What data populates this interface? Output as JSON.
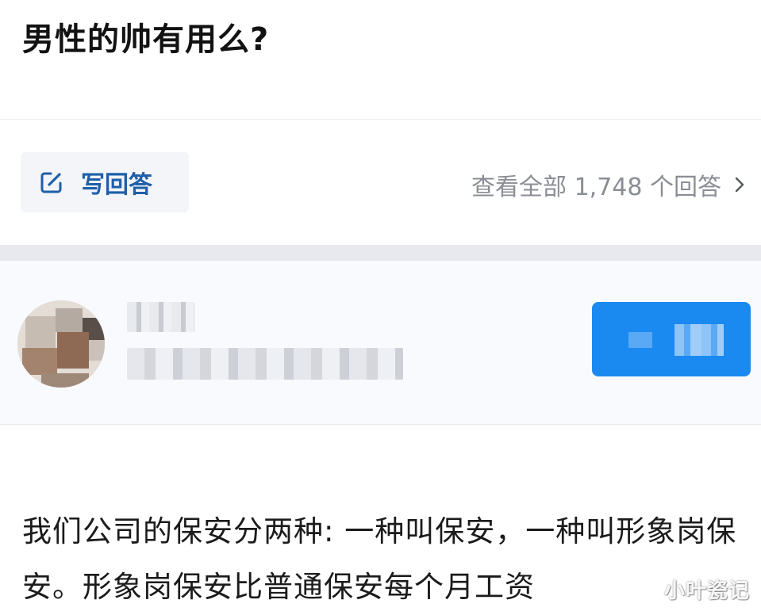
{
  "question": {
    "title": "男性的帅有用么?"
  },
  "actions": {
    "write_answer_label": "写回答",
    "view_all_label": "查看全部 1,748 个回答",
    "accent_color": "#1f5fa8"
  },
  "answer": {
    "text": "我们公司的保安分两种: 一种叫保安，一种叫形象岗保安。形象岗保安比普通保安每个月工资"
  },
  "icons": {
    "write": "edit-icon",
    "view_all": "chevron-right-icon"
  },
  "colors": {
    "follow_button": "#1a8af0",
    "muted_text": "#8a8d94"
  },
  "watermark": "小叶瓷记"
}
